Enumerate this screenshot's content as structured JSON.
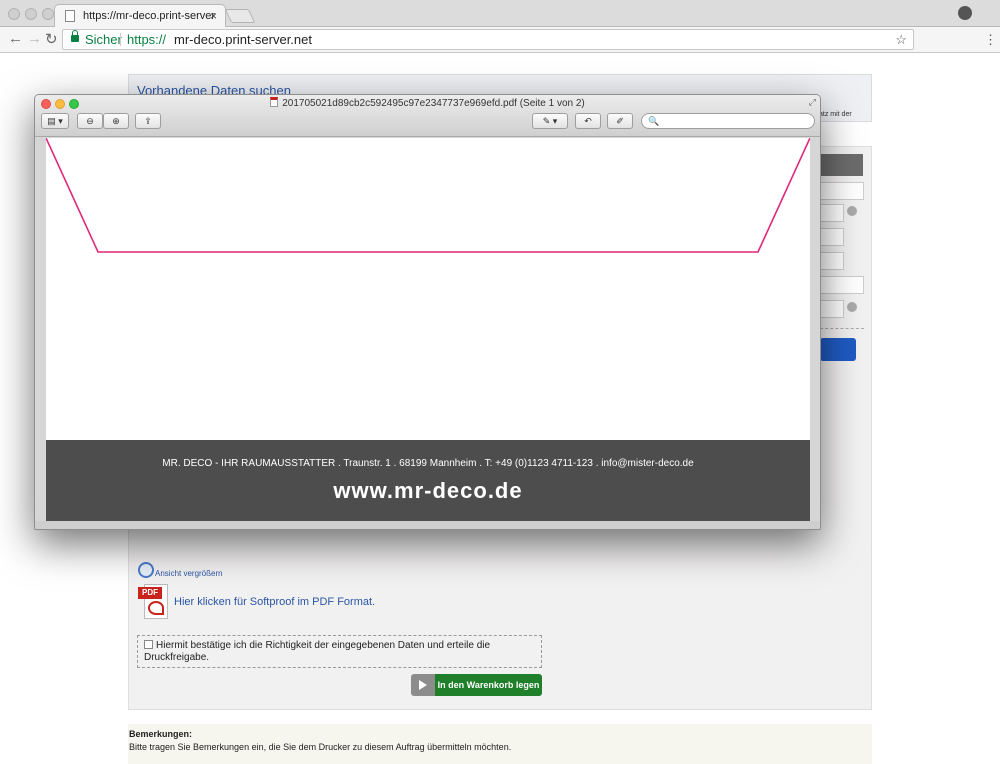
{
  "browser": {
    "tab_title": "https://mr-deco.print-server",
    "tab_close": "×",
    "back_glyph": "←",
    "forward_glyph": "→",
    "reload_glyph": "↻",
    "secure_label": "Sicher",
    "url_protocol": "https://",
    "url_host": "mr-deco.print-server.net",
    "bookmark_glyph": "☆",
    "menu_glyph": "⋮"
  },
  "page": {
    "search_title": "Vorhandene Daten suchen",
    "right_note": "atz mit der",
    "zoom_link": "Ansicht vergrößern",
    "pdf_tag": "PDF",
    "pdf_link": "Hier klicken für Softproof im PDF Format.",
    "confirm_text": "Hiermit bestätige ich die Richtigkeit der eingegebenen Daten und erteile die Druckfreigabe.",
    "cart_button": "In den Warenkorb legen",
    "remarks_title": "Bemerkungen:",
    "remarks_text": "Bitte tragen Sie Bemerkungen ein, die Sie dem Drucker zu diesem Auftrag übermitteln möchten."
  },
  "preview": {
    "title": "201705021d89cb2c592495c97e2347737e969efd.pdf (Seite 1 von 2)",
    "expand_glyph": "⤢",
    "sidebar_btn": "▤ ▾",
    "zoom_out_btn": "⊖",
    "zoom_in_btn": "⊕",
    "share_btn": "⇪",
    "markup_btn": "✎ ▾",
    "rotate_btn": "↶",
    "edit_btn": "✐",
    "search_glyph": "🔍",
    "search_placeholder": "",
    "footer_address": "MR. DECO - IHR RAUMAUSSTATTER . Traunstr. 1 . 68199 Mannheim . T: +49 (0)1123 4711-123 . info@mister-deco.de",
    "footer_web": "www.mr-deco.de",
    "envelope_line_color": "#e0277a"
  }
}
